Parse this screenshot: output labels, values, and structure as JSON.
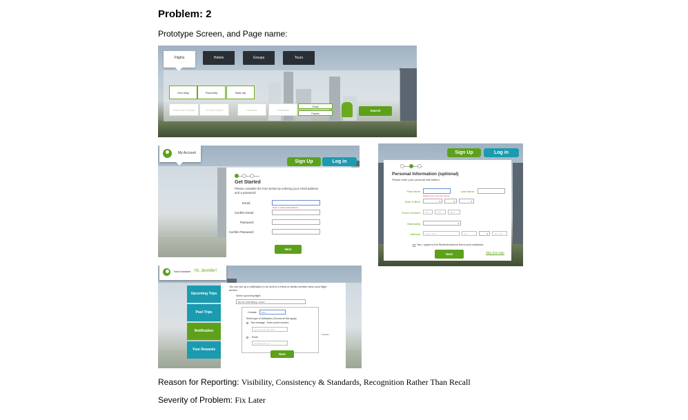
{
  "heading": "Problem: 2",
  "prototype_label": "Prototype Screen, and Page name:",
  "screen1": {
    "tabs": [
      "Flights",
      "Hotels",
      "Groups",
      "Tours"
    ],
    "trip_types": [
      "One-Way",
      "Roundtrip",
      "Multi-trip"
    ],
    "fields": [
      "Place from to depart",
      "To Trip to depart",
      "Departure",
      "Destination"
    ],
    "segment": [
      "Email",
      "Passbk"
    ],
    "search_label": "Search"
  },
  "screen2": {
    "account_label": "My Account",
    "signup_label": "Sign Up",
    "login_label": "Log in",
    "title": "Get Started",
    "instructions": "Please complete the form below by entering your email address and a password.",
    "fields": [
      "Email:",
      "Confirm Email:",
      "Password:",
      "Confirm Password:"
    ],
    "error": "Enter a valid email address!",
    "next_label": "Next"
  },
  "screen3": {
    "signup_label": "Sign Up",
    "login_label": "Log in",
    "title": "Personal Information (optional)",
    "instructions": "Please enter your personal information.",
    "first_name": "First Name:",
    "last_name": "Last Name:",
    "error": "Please enter your first name!",
    "dob": "Date of Birth:",
    "phone": "Phone Number:",
    "phone_placeholders": [
      "000",
      "0000",
      "0000"
    ],
    "nationality": "Nationality:",
    "address": "Address:",
    "address_placeholders": [
      "Street Name",
      "City",
      "Zip Code"
    ],
    "agree": "Yes, I agree to the StudentUniverse terms and conditions.",
    "next_label": "Next",
    "skip_label": "Skip this step"
  },
  "screen4": {
    "greeting_prefix": "Travel Assistant",
    "greeting_name": "Hi, Jennifer!",
    "side_items": [
      "Upcoming Trips",
      "Past Trips",
      "Notification",
      "Your Rewards"
    ],
    "intro": "You can set up a notification to be sent to a friend or family member when your flight arrives.",
    "select_label": "Select upcoming flight:",
    "select_value": "Dec 31, 2016 Beijing - Austin",
    "contact_label": "Contact:",
    "contact_value": "Mom",
    "type_label": "Select type of notification (Choose all that apply):",
    "text_option": "Text message - Enter phone number:",
    "phone_placeholder": "Sample: 512-000-0000",
    "email_option": "Email",
    "email_placeholder": "Email@email.com",
    "side_note": "Add/Edit",
    "next_label": "Next"
  },
  "reason_label": "Reason for Reporting:",
  "reason_value": "Visibility, Consistency & Standards, Recognition Rather Than Recall",
  "severity_label": "Severity of Problem:",
  "severity_value": "Fix Later",
  "colors": {
    "green": "#5da11b",
    "teal": "#1a9bb0",
    "dark_tab": "#2a2f36"
  }
}
